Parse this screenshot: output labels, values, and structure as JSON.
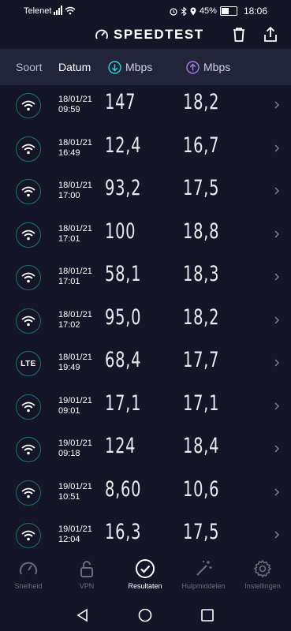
{
  "statusbar": {
    "carrier": "Telenet",
    "battery": "45%",
    "time": "18:06"
  },
  "app": {
    "title": "SPEEDTEST"
  },
  "columns": {
    "type": "Soort",
    "date": "Datum",
    "download_unit": "Mbps",
    "upload_unit": "Mbps"
  },
  "results": [
    {
      "type": "wifi",
      "date": "18/01/21",
      "time": "09:59",
      "download": "147",
      "upload": "18,2"
    },
    {
      "type": "wifi",
      "date": "18/01/21",
      "time": "16:49",
      "download": "12,4",
      "upload": "16,7"
    },
    {
      "type": "wifi",
      "date": "18/01/21",
      "time": "17:00",
      "download": "93,2",
      "upload": "17,5"
    },
    {
      "type": "wifi",
      "date": "18/01/21",
      "time": "17:01",
      "download": "100",
      "upload": "18,8"
    },
    {
      "type": "wifi",
      "date": "18/01/21",
      "time": "17:01",
      "download": "58,1",
      "upload": "18,3"
    },
    {
      "type": "wifi",
      "date": "18/01/21",
      "time": "17:02",
      "download": "95,0",
      "upload": "18,2"
    },
    {
      "type": "LTE",
      "date": "18/01/21",
      "time": "19:49",
      "download": "68,4",
      "upload": "17,7"
    },
    {
      "type": "wifi",
      "date": "19/01/21",
      "time": "09:01",
      "download": "17,1",
      "upload": "17,1"
    },
    {
      "type": "wifi",
      "date": "19/01/21",
      "time": "09:18",
      "download": "124",
      "upload": "18,4"
    },
    {
      "type": "wifi",
      "date": "19/01/21",
      "time": "10:51",
      "download": "8,60",
      "upload": "10,6"
    },
    {
      "type": "wifi",
      "date": "19/01/21",
      "time": "12:04",
      "download": "16,3",
      "upload": "17,5"
    }
  ],
  "nav": [
    {
      "label": "Snelheid",
      "icon": "gauge-icon",
      "active": false
    },
    {
      "label": "VPN",
      "icon": "lock-icon",
      "active": false
    },
    {
      "label": "Resultaten",
      "icon": "check-circle-icon",
      "active": true
    },
    {
      "label": "Hulpmiddelen",
      "icon": "magic-wand-icon",
      "active": false
    },
    {
      "label": "Instellingen",
      "icon": "gear-icon",
      "active": false
    }
  ],
  "colors": {
    "background": "#141526",
    "header_bar": "#22253a",
    "download_accent": "#39d0d8",
    "upload_accent": "#a77ce0",
    "badge_ring": "#1e6f7a"
  }
}
